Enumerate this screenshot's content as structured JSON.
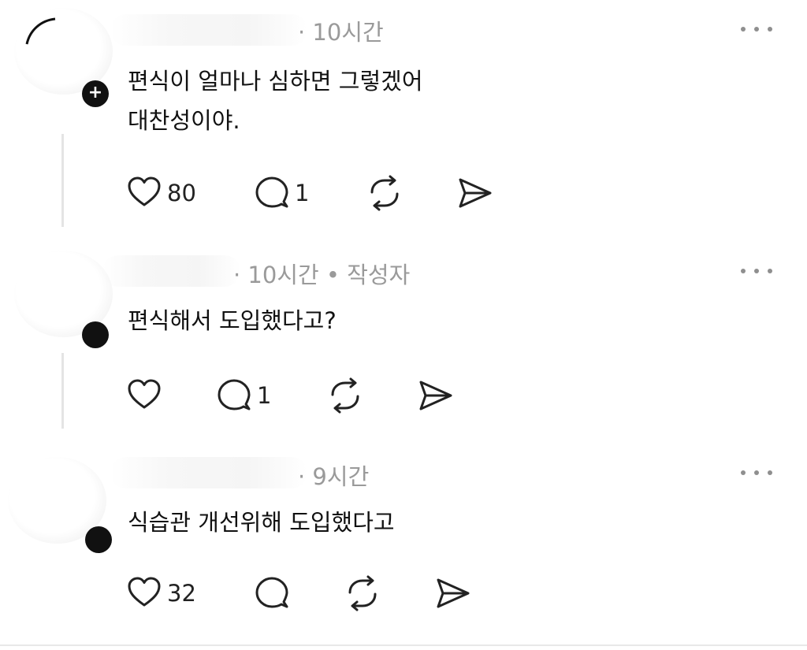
{
  "posts": [
    {
      "time": "· 10시간",
      "author_tag": "",
      "text_lines": [
        "편식이 얼마나 심하면 그렇겠어",
        "대찬성이야."
      ],
      "likes": "80",
      "replies": "1",
      "follow_badge": "+"
    },
    {
      "time": "· 10시간",
      "author_tag": "• 작성자",
      "text_lines": [
        "편식해서 도입했다고?"
      ],
      "likes": "",
      "replies": "1",
      "follow_badge": ""
    },
    {
      "time": "· 9시간",
      "author_tag": "",
      "text_lines": [
        "식습관 개선위해 도입했다고"
      ],
      "likes": "32",
      "replies": "",
      "follow_badge": ""
    }
  ],
  "icons": {
    "like": "heart-icon",
    "reply": "comment-icon",
    "repost": "repost-icon",
    "share": "send-icon",
    "more": "more-dots-icon"
  }
}
